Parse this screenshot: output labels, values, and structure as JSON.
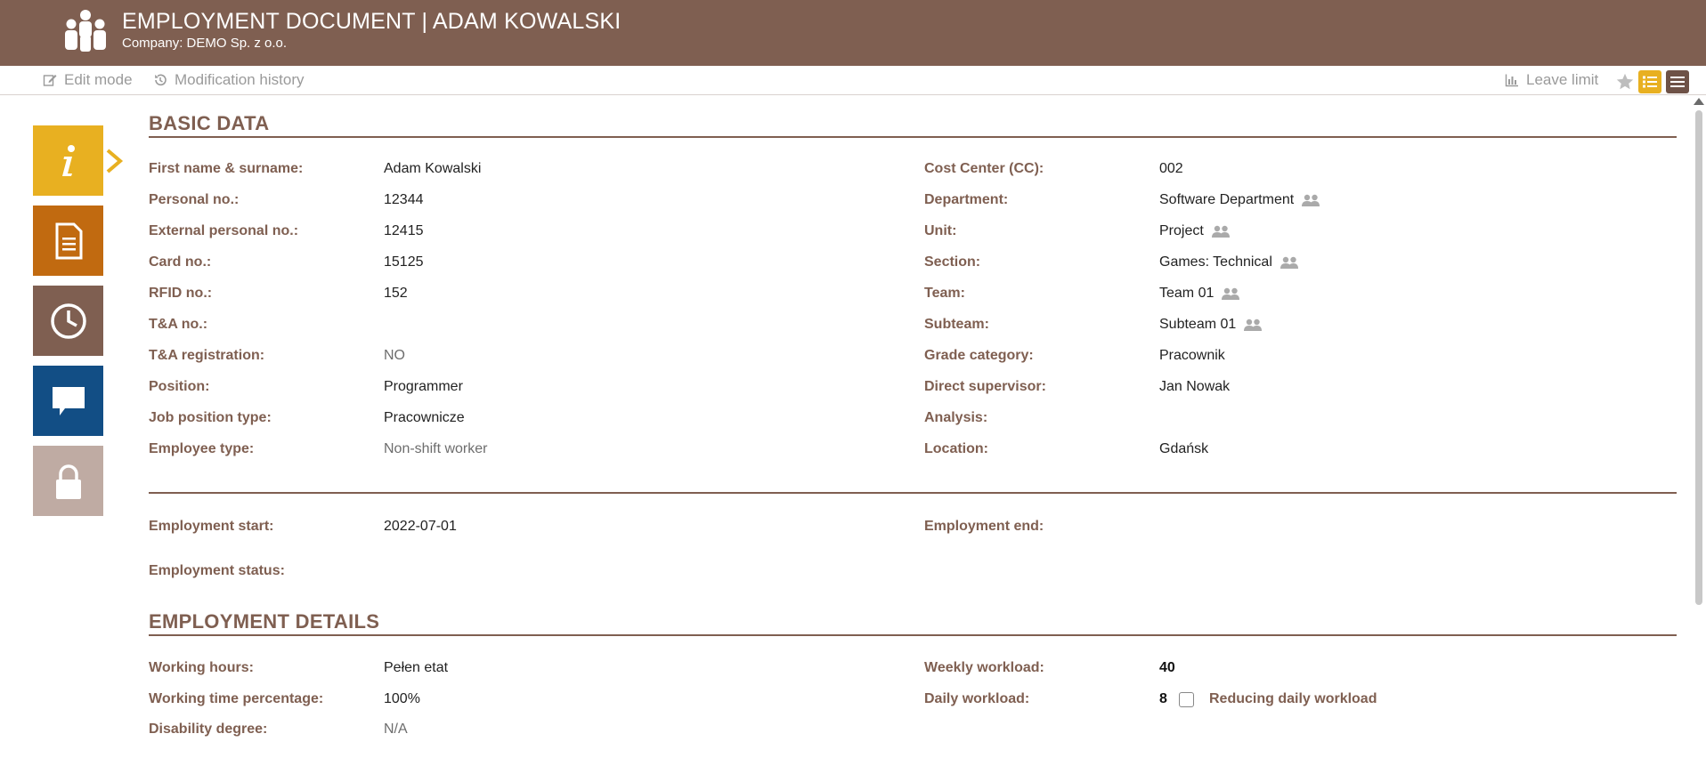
{
  "header": {
    "title": "EMPLOYMENT DOCUMENT | ADAM KOWALSKI",
    "company": "Company: DEMO Sp. z o.o."
  },
  "toolbar": {
    "edit_mode": "Edit mode",
    "modification_history": "Modification history",
    "leave_limit": "Leave limit"
  },
  "sidebar": {
    "items": [
      {
        "icon": "info-icon",
        "color": "#e8b021"
      },
      {
        "icon": "document-icon",
        "color": "#c16a10"
      },
      {
        "icon": "clock-icon",
        "color": "#7f5f51"
      },
      {
        "icon": "chat-icon",
        "color": "#124e85"
      },
      {
        "icon": "lock-icon",
        "color": "#bfaba3"
      }
    ]
  },
  "basic": {
    "title": "BASIC DATA",
    "left": [
      {
        "label": "First name & surname:",
        "value": "Adam Kowalski"
      },
      {
        "label": "Personal no.:",
        "value": "12344"
      },
      {
        "label": "External personal no.:",
        "value": "12415"
      },
      {
        "label": "Card no.:",
        "value": "15125"
      },
      {
        "label": "RFID no.:",
        "value": "152"
      },
      {
        "label": "T&A no.:",
        "value": ""
      },
      {
        "label": "T&A registration:",
        "value": "NO"
      },
      {
        "label": "Position:",
        "value": "Programmer"
      },
      {
        "label": "Job position type:",
        "value": "Pracownicze"
      },
      {
        "label": "Employee type:",
        "value": "Non-shift worker"
      }
    ],
    "right": [
      {
        "label": "Cost Center (CC):",
        "value": "002"
      },
      {
        "label": "Department:",
        "value": "Software Department"
      },
      {
        "label": "Unit:",
        "value": "Project"
      },
      {
        "label": "Section:",
        "value": "Games: Technical"
      },
      {
        "label": "Team:",
        "value": "Team 01"
      },
      {
        "label": "Subteam:",
        "value": "Subteam 01"
      },
      {
        "label": "Grade category:",
        "value": "Pracownik"
      },
      {
        "label": "Direct supervisor:",
        "value": "Jan Nowak"
      },
      {
        "label": "Analysis:",
        "value": ""
      },
      {
        "label": "Location:",
        "value": "Gdańsk"
      }
    ]
  },
  "employment": {
    "start_label": "Employment start:",
    "start_value": "2022-07-01",
    "end_label": "Employment end:",
    "end_value": "",
    "status_label": "Employment status:",
    "status_value": ""
  },
  "details": {
    "title": "EMPLOYMENT DETAILS",
    "working_hours_label": "Working hours:",
    "working_hours_value": "Pełen etat",
    "percentage_label": "Working time percentage:",
    "percentage_value": "100%",
    "disability_label": "Disability degree:",
    "disability_value": "N/A",
    "weekly_label": "Weekly workload:",
    "weekly_value": "40",
    "daily_label": "Daily workload:",
    "daily_value": "8",
    "reducing_label": "Reducing daily workload"
  }
}
